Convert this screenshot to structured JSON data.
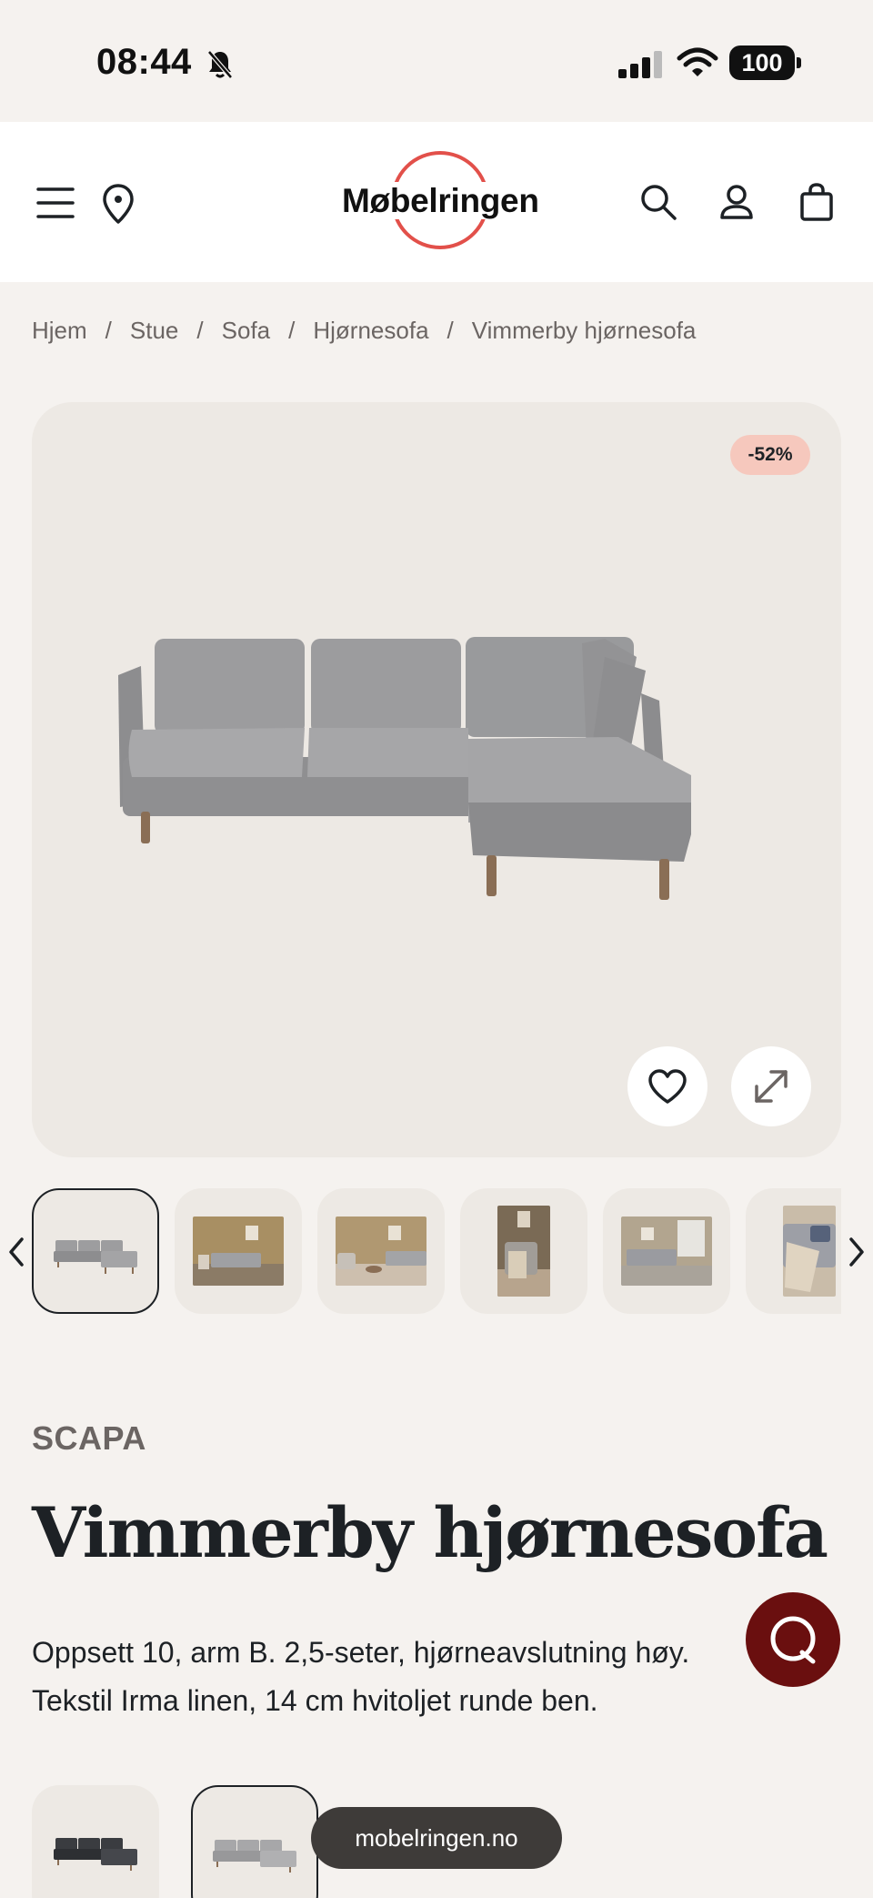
{
  "status_bar": {
    "time": "08:44",
    "battery": "100",
    "icons": [
      "bell-slash-icon",
      "cellular-signal-icon",
      "wifi-icon",
      "battery-icon"
    ]
  },
  "header": {
    "logo_text": "Møbelringen",
    "icons": [
      "menu-icon",
      "store-location-icon",
      "search-icon",
      "account-icon",
      "cart-icon"
    ],
    "brand_color": "#e2504a"
  },
  "breadcrumb": [
    "Hjem",
    "Stue",
    "Sofa",
    "Hjørnesofa",
    "Vimmerby hjørnesofa"
  ],
  "breadcrumb_separator": "/",
  "gallery": {
    "discount_badge": "-52%",
    "icons": [
      "heart-icon",
      "expand-icon"
    ],
    "thumbnail_count": 6,
    "selected_thumbnail": 1
  },
  "product": {
    "brand": "SCAPA",
    "title": "Vimmerby hjørnesofa",
    "description_line1": "Oppsett 10, arm B. 2,5-seter, hjørneavslutning høy.",
    "description_line2": "Tekstil Irma linen, 14 cm hvitoljet runde ben."
  },
  "variants": {
    "count": 2,
    "selected": 2
  },
  "chat": {
    "icon": "chat-bubble-icon",
    "color": "#6a0f0f"
  },
  "browser": {
    "url": "mobelringen.no"
  }
}
